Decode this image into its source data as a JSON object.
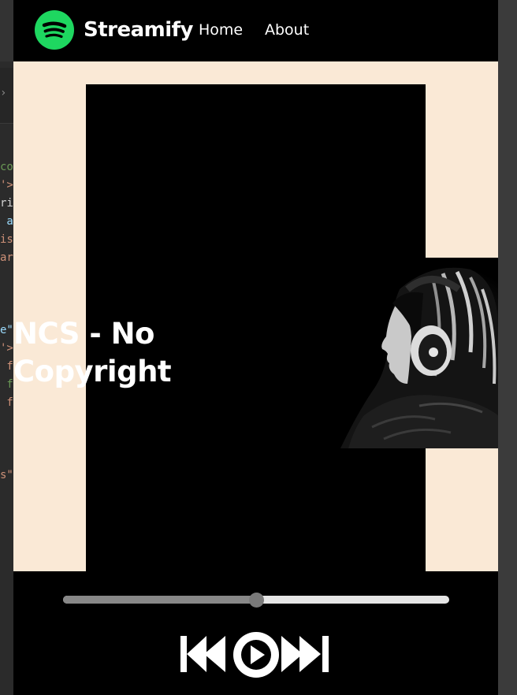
{
  "editor": {
    "gutter_lines": [
      "co",
      "'>",
      "ri",
      " a",
      "is",
      "ar",
      "",
      "",
      "",
      "e\"",
      "'>",
      " f",
      " f",
      " f",
      "",
      "",
      "",
      "s\""
    ]
  },
  "navbar": {
    "brand": "Streamify",
    "logo_icon": "spotify-logo-icon",
    "links": [
      "Home",
      "About"
    ]
  },
  "song": {
    "title": "NCS - No Copyright"
  },
  "player": {
    "progress_percent": 50,
    "controls": [
      "previous-icon",
      "play-icon",
      "next-icon"
    ]
  },
  "colors": {
    "accent": "#1ed760",
    "main_bg": "#fae9d6",
    "player_bg": "#000000"
  }
}
